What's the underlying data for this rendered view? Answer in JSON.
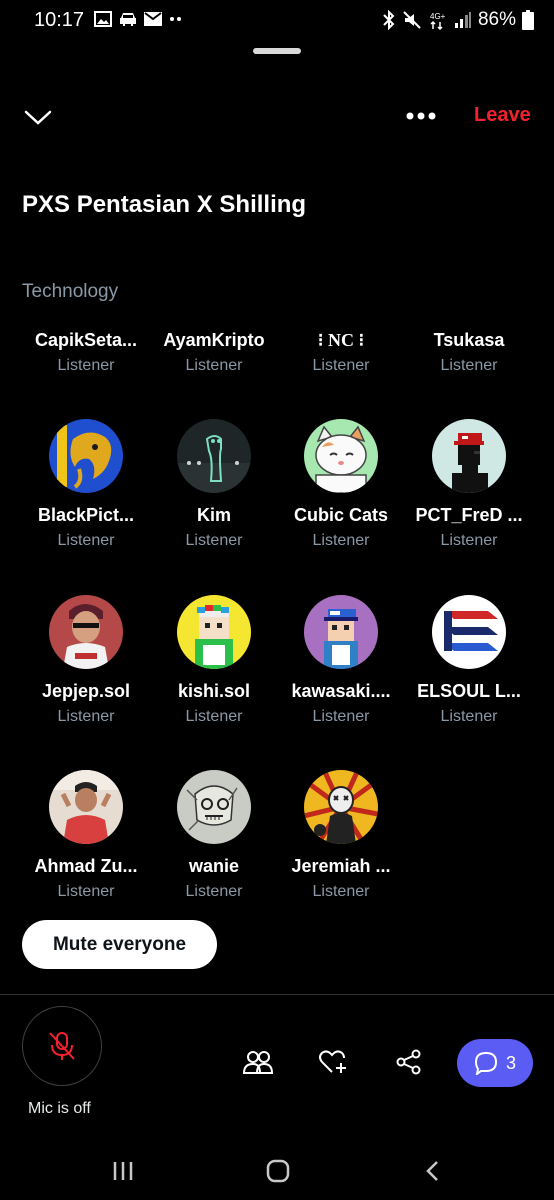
{
  "status_bar": {
    "time": "10:17",
    "battery": "86%",
    "icons": [
      "image-icon",
      "car-icon",
      "mail-icon",
      "dots-icon",
      "bluetooth-icon",
      "mute-icon",
      "4g-icon",
      "signal-icon",
      "battery-icon"
    ]
  },
  "header": {
    "leave_label": "Leave",
    "leave_color": "#f4212e"
  },
  "space": {
    "title": "PXS Pentasian X Shilling",
    "topic": "Technology"
  },
  "participants": [
    {
      "name": "CapikSeta...",
      "role": "Listener",
      "avatar": "none"
    },
    {
      "name": "AyamKripto",
      "role": "Listener",
      "avatar": "none"
    },
    {
      "name": "⁝ NC ⁝",
      "role": "Listener",
      "avatar": "none"
    },
    {
      "name": "Tsukasa",
      "role": "Listener",
      "avatar": "none"
    },
    {
      "name": "BlackPict...",
      "role": "Listener",
      "avatar": "elephant-blue-gold"
    },
    {
      "name": "Kim",
      "role": "Listener",
      "avatar": "dark-night-figure"
    },
    {
      "name": "Cubic Cats",
      "role": "Listener",
      "avatar": "cartoon-cat-green"
    },
    {
      "name": "PCT_FreD ...",
      "role": "Listener",
      "avatar": "pixel-red-cap"
    },
    {
      "name": "Jepjep.sol",
      "role": "Listener",
      "avatar": "photo-person"
    },
    {
      "name": "kishi.sol",
      "role": "Listener",
      "avatar": "pixel-yellow"
    },
    {
      "name": "kawasaki....",
      "role": "Listener",
      "avatar": "pixel-purple"
    },
    {
      "name": "ELSOUL L...",
      "role": "Listener",
      "avatar": "elsoul-logo"
    },
    {
      "name": "Ahmad Zu...",
      "role": "Listener",
      "avatar": "photo-person-red"
    },
    {
      "name": "wanie",
      "role": "Listener",
      "avatar": "sketch-art"
    },
    {
      "name": "Jeremiah ...",
      "role": "Listener",
      "avatar": "art-yellow-rays"
    }
  ],
  "controls": {
    "mute_everyone_label": "Mute everyone",
    "mic_label": "Mic is off",
    "comments_count": "3",
    "accent": "#5a5cf4"
  }
}
